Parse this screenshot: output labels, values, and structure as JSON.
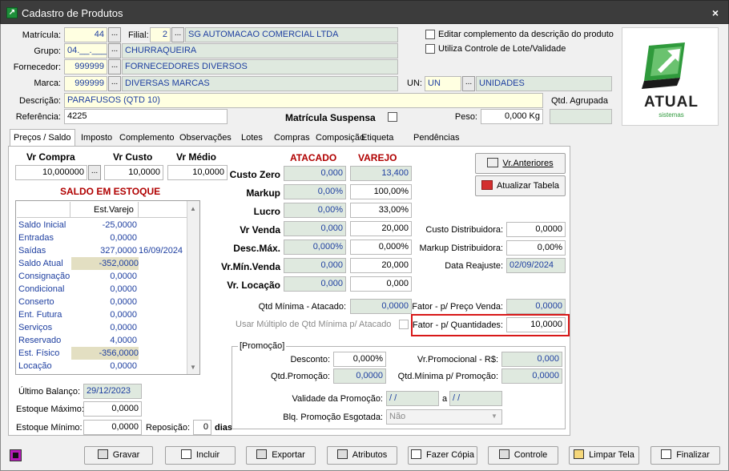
{
  "window": {
    "title": "Cadastro de Produtos",
    "close": "×"
  },
  "header": {
    "matricula_label": "Matrícula:",
    "matricula": "44",
    "filial_label": "Filial:",
    "filial": "2",
    "filial_name": "SG AUTOMACAO COMERCIAL LTDA",
    "grupo_label": "Grupo:",
    "grupo": "04.__.___",
    "grupo_name": "CHURRAQUEIRA",
    "fornecedor_label": "Fornecedor:",
    "fornecedor": "999999",
    "fornecedor_name": "FORNECEDORES DIVERSOS",
    "marca_label": "Marca:",
    "marca": "999999",
    "marca_name": "DIVERSAS MARCAS",
    "un_label": "UN:",
    "un": "UN",
    "un_name": "UNIDADES",
    "descricao_label": "Descrição:",
    "descricao": "PARAFUSOS (QTD 10)",
    "referencia_label": "Referência:",
    "referencia": "4225",
    "matricula_suspensa_label": "Matrícula Suspensa",
    "peso_label": "Peso:",
    "peso": "0,000 Kg",
    "qtd_agrupada_label": "Qtd. Agrupada",
    "chk_editar_label": "Editar complemento da descrição do produto",
    "chk_lote_label": "Utiliza Controle de Lote/Validade",
    "browse": "..."
  },
  "logo": {
    "text": "ATUAL",
    "sub": "sistemas"
  },
  "tabs": [
    "Preços / Saldo",
    "Imposto",
    "Complemento",
    "Observações",
    "Lotes",
    "Compras",
    "Composição",
    "Etiqueta",
    "Pendências"
  ],
  "prices": {
    "vr_compra_label": "Vr Compra",
    "vr_compra": "10,000000",
    "vr_custo_label": "Vr Custo",
    "vr_custo": "10,0000",
    "vr_medio_label": "Vr Médio",
    "vr_medio": "10,0000"
  },
  "saldo": {
    "title": "SALDO EM ESTOQUE",
    "col_header": "Est.Varejo",
    "rows": [
      {
        "label": "Saldo Inicial",
        "value": "-25,0000",
        "date": ""
      },
      {
        "label": "Entradas",
        "value": "0,0000",
        "date": ""
      },
      {
        "label": "Saídas",
        "value": "327,0000",
        "date": "16/09/2024"
      },
      {
        "label": "Saldo Atual",
        "value": "-352,0000",
        "date": ""
      },
      {
        "label": "Consignação",
        "value": "0,0000",
        "date": ""
      },
      {
        "label": "Condicional",
        "value": "0,0000",
        "date": ""
      },
      {
        "label": "Conserto",
        "value": "0,0000",
        "date": ""
      },
      {
        "label": "Ent. Futura",
        "value": "0,0000",
        "date": ""
      },
      {
        "label": "Serviços",
        "value": "0,0000",
        "date": ""
      },
      {
        "label": "Reservado",
        "value": "4,0000",
        "date": ""
      },
      {
        "label": "Est. Físico",
        "value": "-356,0000",
        "date": ""
      },
      {
        "label": "Locação",
        "value": "0,0000",
        "date": ""
      }
    ],
    "ultimo_balanco_label": "Último Balanço:",
    "ultimo_balanco": "29/12/2023",
    "estoque_maximo_label": "Estoque Máximo:",
    "estoque_maximo": "0,0000",
    "estoque_minimo_label": "Estoque Mínimo:",
    "estoque_minimo": "0,0000",
    "reposicao_label": "Reposição:",
    "reposicao": "0",
    "dias_label": "dias"
  },
  "pricing": {
    "atacado_header": "ATACADO",
    "varejo_header": "VAREJO",
    "rows": [
      {
        "label": "Custo Zero",
        "atacado": "0,000",
        "varejo": "13,400"
      },
      {
        "label": "Markup",
        "atacado": "0,00%",
        "varejo": "100,00%"
      },
      {
        "label": "Lucro",
        "atacado": "0,00%",
        "varejo": "33,00%"
      },
      {
        "label": "Vr Venda",
        "atacado": "0,000",
        "varejo": "20,000"
      },
      {
        "label": "Desc.Máx.",
        "atacado": "0,000%",
        "varejo": "0,000%"
      },
      {
        "label": "Vr.Mín.Venda",
        "atacado": "0,000",
        "varejo": "20,000"
      },
      {
        "label": "Vr. Locação",
        "atacado": "0,000",
        "varejo": "0,000"
      }
    ],
    "custo_distribuidora_label": "Custo Distribuidora:",
    "custo_distribuidora": "0,0000",
    "markup_distribuidora_label": "Markup Distribuidora:",
    "markup_distribuidora": "0,00%",
    "data_reajuste_label": "Data Reajuste:",
    "data_reajuste": "02/09/2024",
    "qtd_minima_atacado_label": "Qtd Mínima - Atacado:",
    "qtd_minima_atacado": "0,0000",
    "fator_preco_venda_label": "Fator - p/ Preço Venda:",
    "fator_preco_venda": "0,0000",
    "usar_multiplo_label": "Usar Múltiplo de Qtd Mínima p/ Atacado",
    "fator_quantidades_label": "Fator - p/ Quantidades:",
    "fator_quantidades": "10,0000",
    "vr_anteriores": "Vr.Anteriores",
    "atualizar_tabela": "Atualizar Tabela"
  },
  "promocao": {
    "title": "[Promoção]",
    "desconto_label": "Desconto:",
    "desconto": "0,000%",
    "vr_promocional_label": "Vr.Promocional - R$:",
    "vr_promocional": "0,000",
    "qtd_promocao_label": "Qtd.Promoção:",
    "qtd_promocao": "0,0000",
    "qtd_minima_promocao_label": "Qtd.Mínima p/ Promoção:",
    "qtd_minima_promocao": "0,0000",
    "validade_label": "Validade da Promoção:",
    "validade_de": "/ /",
    "validade_a_label": "a",
    "validade_ate": "/ /",
    "blq_label": "Blq. Promoção Esgotada:",
    "blq": "Não"
  },
  "footer": {
    "gravar": "Gravar",
    "incluir": "Incluir",
    "exportar": "Exportar",
    "atributos": "Atributos",
    "fazer_copia": "Fazer Cópia",
    "controle": "Controle",
    "limpar_tela": "Limpar Tela",
    "finalizar": "Finalizar"
  },
  "colors": {
    "accent_red": "#d81818",
    "label_blue": "#1e3fa0",
    "highlight_yellow": "#ffffe1",
    "readonly_green": "#dfe9df"
  }
}
